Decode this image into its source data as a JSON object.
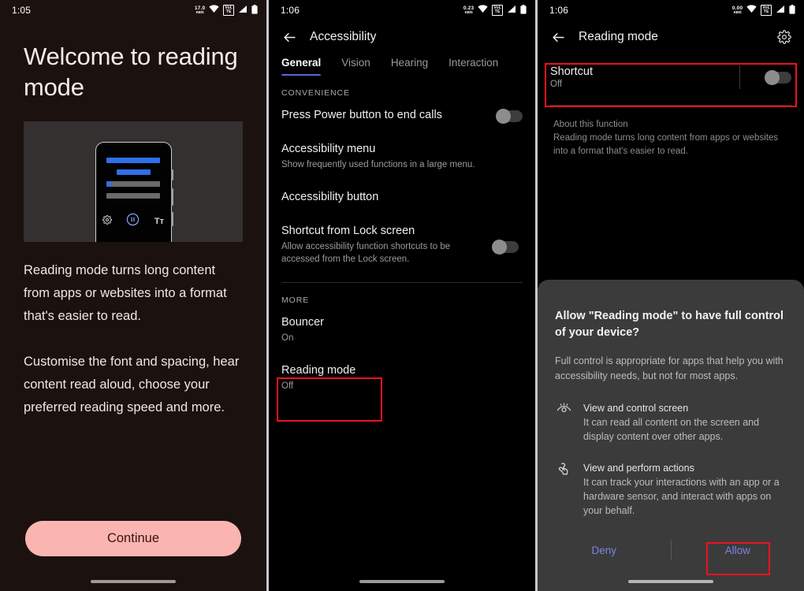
{
  "panel1": {
    "status": {
      "time": "1:05",
      "net_rate_value": "17.0",
      "net_rate_unit": "KB/S",
      "volte": "VoLTE"
    },
    "title": "Welcome to reading mode",
    "hero": {
      "icons": [
        "gear-icon",
        "pause-icon",
        "text-size-icon"
      ],
      "text_size_label": "Tт"
    },
    "paragraphs": [
      "Reading mode turns long content from apps or websites into a format that's easier to read.",
      "Customise the font and spacing, hear content read aloud, choose your preferred reading speed and more."
    ],
    "continue_label": "Continue"
  },
  "panel2": {
    "status": {
      "time": "1:06",
      "net_rate_value": "0.23",
      "net_rate_unit": "KB/S",
      "volte": "VoLTE"
    },
    "appbar": {
      "title": "Accessibility",
      "back_icon": "arrow-left-icon"
    },
    "tabs": [
      {
        "label": "General",
        "active": true
      },
      {
        "label": "Vision",
        "active": false
      },
      {
        "label": "Hearing",
        "active": false
      },
      {
        "label": "Interaction",
        "active": false
      }
    ],
    "section_convenience": "CONVENIENCE",
    "rows_convenience": [
      {
        "title": "Press Power button to end calls",
        "sub": "",
        "toggle": "off"
      },
      {
        "title": "Accessibility menu",
        "sub": "Show frequently used functions in a large menu.",
        "toggle": null
      },
      {
        "title": "Accessibility button",
        "sub": "",
        "toggle": null
      },
      {
        "title": "Shortcut from Lock screen",
        "sub": "Allow accessibility function shortcuts to be accessed from the Lock screen.",
        "toggle": "off"
      }
    ],
    "section_more": "MORE",
    "rows_more": [
      {
        "title": "Bouncer",
        "sub": "On"
      },
      {
        "title": "Reading mode",
        "sub": "Off"
      }
    ]
  },
  "panel3": {
    "status": {
      "time": "1:06",
      "net_rate_value": "0.00",
      "net_rate_unit": "KB/S",
      "volte": "VoLTE"
    },
    "appbar": {
      "title": "Reading mode",
      "back_icon": "arrow-left-icon",
      "settings_icon": "gear-icon"
    },
    "shortcut": {
      "title": "Shortcut",
      "sub": "Off",
      "toggle": "off"
    },
    "about": {
      "title": "About this function",
      "text": "Reading mode turns long content from apps or websites into a format that's easier to read."
    },
    "dialog": {
      "title": "Allow \"Reading mode\" to have full control of your device?",
      "subtitle": "Full control is appropriate for apps that help you with accessibility needs, but not for most apps.",
      "permissions": [
        {
          "icon": "eye-icon",
          "title": "View and control screen",
          "text": "It can read all content on the screen and display content over other apps."
        },
        {
          "icon": "tap-gesture-icon",
          "title": "View and perform actions",
          "text": "It can track your interactions with an app or a hardware sensor, and interact with apps on your behalf."
        }
      ],
      "deny_label": "Deny",
      "allow_label": "Allow"
    }
  },
  "colors": {
    "highlight": "#ee1122",
    "accent_blue": "#2f6fe8",
    "tab_underline": "#5b67d8",
    "cta_bg": "#fab5b1",
    "dialog_bg": "#3b3b3b",
    "link": "#7b83e8"
  }
}
